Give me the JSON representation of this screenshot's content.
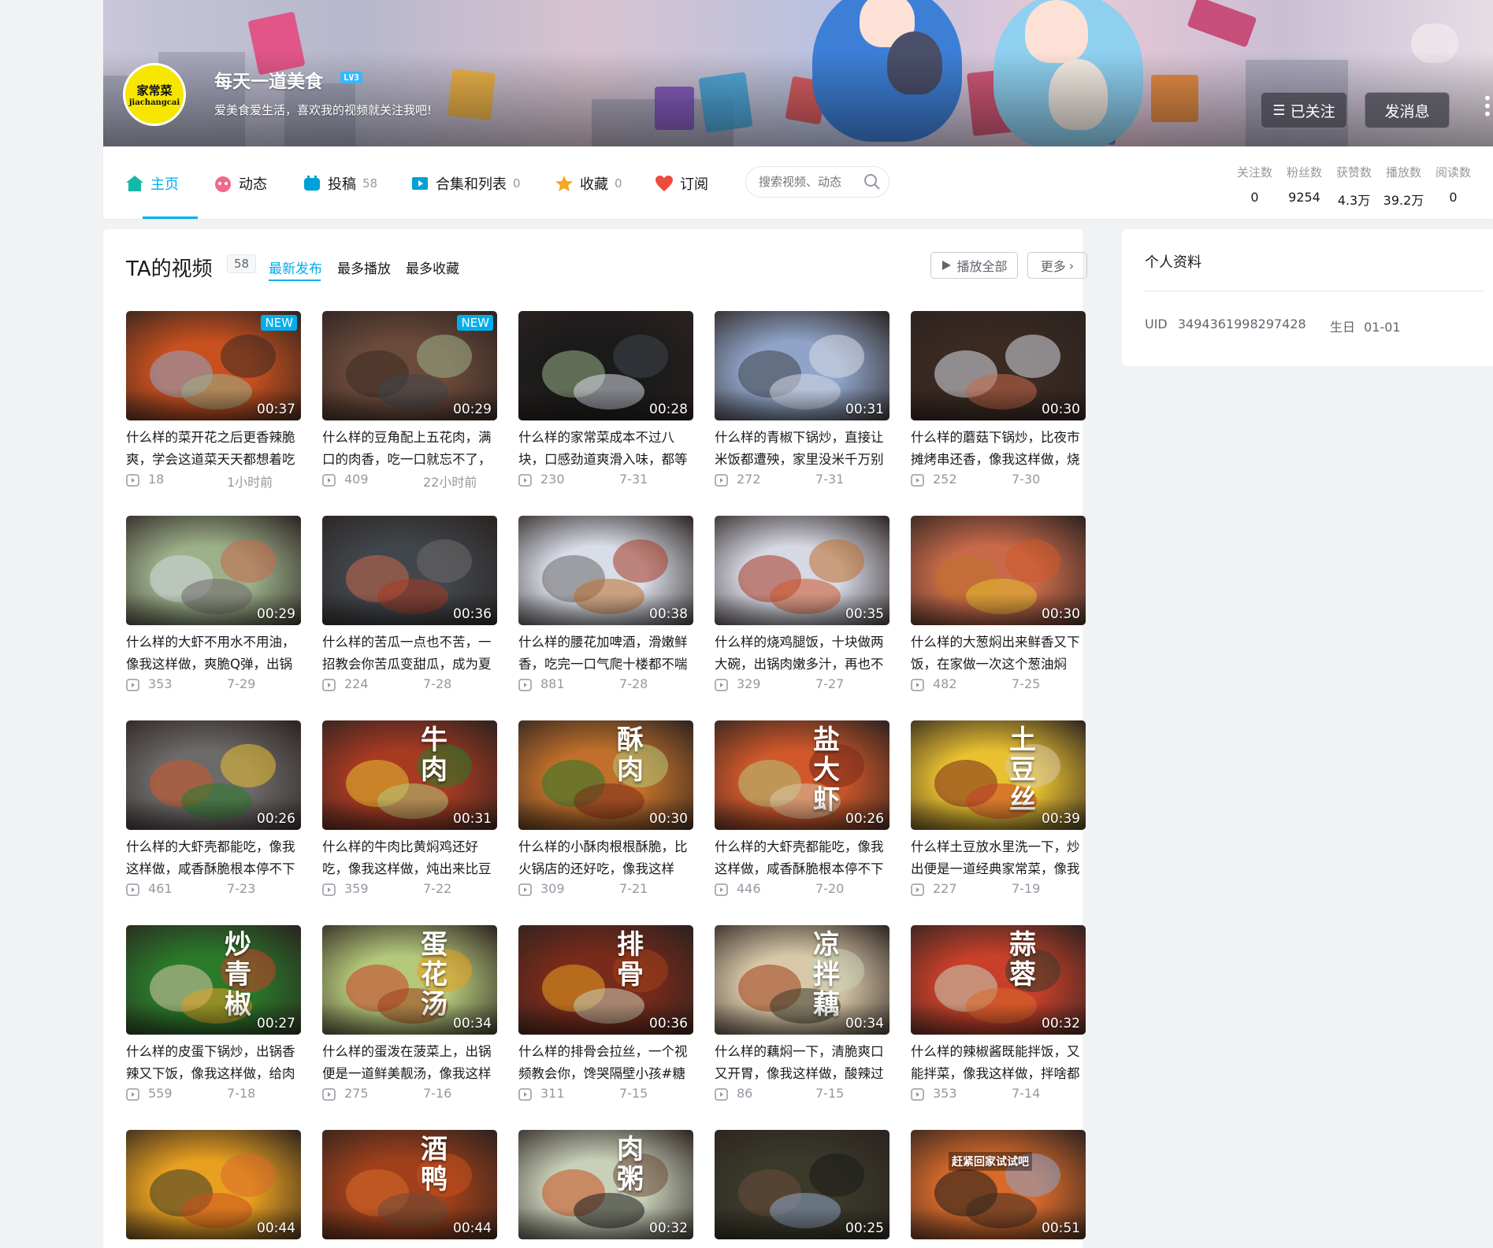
{
  "profile": {
    "username": "每天一道美食",
    "level": "LV3",
    "signature": "爱美食爱生活，喜欢我的视频就关注我吧!",
    "avatar_line1": "家常菜",
    "avatar_line2": "jiachangcai",
    "followed_label": "已关注",
    "message_label": "发消息"
  },
  "nav": {
    "items": [
      {
        "label": "主页",
        "count": "",
        "icon": "home-icon"
      },
      {
        "label": "动态",
        "count": "",
        "icon": "dynamic-icon"
      },
      {
        "label": "投稿",
        "count": "58",
        "icon": "upload-icon"
      },
      {
        "label": "合集和列表",
        "count": "0",
        "icon": "collection-icon"
      },
      {
        "label": "收藏",
        "count": "0",
        "icon": "star-icon"
      },
      {
        "label": "订阅",
        "count": "",
        "icon": "heart-icon"
      }
    ],
    "search_placeholder": "搜索视频、动态"
  },
  "stats": [
    {
      "label": "关注数",
      "value": "0"
    },
    {
      "label": "粉丝数",
      "value": "9254"
    },
    {
      "label": "获赞数",
      "value": "4.3万"
    },
    {
      "label": "播放数",
      "value": "39.2万"
    },
    {
      "label": "阅读数",
      "value": "0"
    }
  ],
  "videos_section": {
    "title": "TA的视频",
    "count": "58",
    "sort_tabs": [
      "最新发布",
      "最多播放",
      "最多收藏"
    ],
    "play_all": "播放全部",
    "more": "更多"
  },
  "videos": [
    {
      "title": "什么样的菜开花之后更香辣脆爽，学会这道菜天天都想着吃",
      "duration": "00:37",
      "plays": "18",
      "date": "1小时前",
      "badge": "NEW"
    },
    {
      "title": "什么样的豆角配上五花肉，满口的肉香，吃一口就忘不了，",
      "duration": "00:29",
      "plays": "409",
      "date": "22小时前",
      "badge": "NEW"
    },
    {
      "title": "什么样的家常菜成本不过八块，口感劲道爽滑入味，都等",
      "duration": "00:28",
      "plays": "230",
      "date": "7-31",
      "badge": ""
    },
    {
      "title": "什么样的青椒下锅炒，直接让米饭都遭殃，家里没米千万别",
      "duration": "00:31",
      "plays": "272",
      "date": "7-31",
      "badge": ""
    },
    {
      "title": "什么样的蘑菇下锅炒，比夜市摊烤串还香，像我这样做，烧",
      "duration": "00:30",
      "plays": "252",
      "date": "7-30",
      "badge": ""
    },
    {
      "title": "什么样的大虾不用水不用油，像我这样做，爽脆Q弹，出锅",
      "duration": "00:29",
      "plays": "353",
      "date": "7-29",
      "badge": ""
    },
    {
      "title": "什么样的苦瓜一点也不苦，一招教会你苦瓜变甜瓜，成为夏",
      "duration": "00:36",
      "plays": "224",
      "date": "7-28",
      "badge": ""
    },
    {
      "title": "什么样的腰花加啤酒，滑嫩鲜香，吃完一口气爬十楼都不喘",
      "duration": "00:38",
      "plays": "881",
      "date": "7-28",
      "badge": ""
    },
    {
      "title": "什么样的烧鸡腿饭，十块做两大碗，出锅肉嫩多汁，再也不",
      "duration": "00:35",
      "plays": "329",
      "date": "7-27",
      "badge": ""
    },
    {
      "title": "什么样的大葱焖出来鲜香又下饭，在家做一次这个葱油焖",
      "duration": "00:30",
      "plays": "482",
      "date": "7-25",
      "badge": ""
    },
    {
      "title": "什么样的大虾壳都能吃，像我这样做，咸香酥脆根本停不下",
      "duration": "00:26",
      "plays": "461",
      "date": "7-23",
      "badge": ""
    },
    {
      "title": "什么样的牛肉比黄焖鸡还好吃，像我这样做，炖出来比豆",
      "duration": "00:31",
      "plays": "359",
      "date": "7-22",
      "badge": ""
    },
    {
      "title": "什么样的小酥肉根根酥脆，比火锅店的还好吃，像我这样",
      "duration": "00:30",
      "plays": "309",
      "date": "7-21",
      "badge": ""
    },
    {
      "title": "什么样的大虾壳都能吃，像我这样做，咸香酥脆根本停不下",
      "duration": "00:26",
      "plays": "446",
      "date": "7-20",
      "badge": ""
    },
    {
      "title": "什么样土豆放水里洗一下，炒出便是一道经典家常菜，像我",
      "duration": "00:39",
      "plays": "227",
      "date": "7-19",
      "badge": ""
    },
    {
      "title": "什么样的皮蛋下锅炒，出锅香辣又下饭，像我这样做，给肉",
      "duration": "00:27",
      "plays": "559",
      "date": "7-18",
      "badge": ""
    },
    {
      "title": "什么样的蛋泼在菠菜上，出锅便是一道鲜美靓汤，像我这样",
      "duration": "00:34",
      "plays": "275",
      "date": "7-16",
      "badge": ""
    },
    {
      "title": "什么样的排骨会拉丝，一个视频教会你，馋哭隔壁小孩#糖",
      "duration": "00:36",
      "plays": "311",
      "date": "7-15",
      "badge": ""
    },
    {
      "title": "什么样的藕焖一下，清脆爽口又开胃，像我这样做，酸辣过",
      "duration": "00:34",
      "plays": "86",
      "date": "7-15",
      "badge": ""
    },
    {
      "title": "什么样的辣椒酱既能拌饭，又能拌菜，像我这样做，拌啥都",
      "duration": "00:32",
      "plays": "353",
      "date": "7-14",
      "badge": ""
    },
    {
      "title": "",
      "duration": "00:44",
      "plays": "",
      "date": "",
      "badge": ""
    },
    {
      "title": "",
      "duration": "00:44",
      "plays": "",
      "date": "",
      "badge": ""
    },
    {
      "title": "",
      "duration": "00:32",
      "plays": "",
      "date": "",
      "badge": ""
    },
    {
      "title": "",
      "duration": "00:25",
      "plays": "",
      "date": "",
      "badge": ""
    },
    {
      "title": "",
      "duration": "00:51",
      "plays": "",
      "date": "",
      "badge": ""
    }
  ],
  "thumb_overlays": {
    "12": "牛肉",
    "13": "酥肉",
    "14": "盐大虾",
    "15": "土豆丝",
    "16": "炒青椒",
    "17": "蛋花汤",
    "18": "排骨",
    "19": "凉拌藕",
    "20": "蒜蓉",
    "22": "酒鸭",
    "23": "肉粥",
    "25": "赶紧回家试试吧"
  },
  "sidebar": {
    "title": "个人资料",
    "uid_label": "UID",
    "uid": "3494361998297428",
    "birthday_label": "生日",
    "birthday": "01-01"
  },
  "colors": {
    "accent": "#00aeec",
    "thumb_palette": [
      "#c8501e",
      "#6b4a3a",
      "#1a1a1a",
      "#8fa4c8",
      "#3a2a22",
      "#9cb08a",
      "#40464c",
      "#d8dde8",
      "#d6d8e4",
      "#c86a4a",
      "#6d6a6a",
      "#a83a22",
      "#c0702a",
      "#d0582a",
      "#e8c030",
      "#2a7a2a",
      "#b4c87a",
      "#7a2a1a",
      "#d8c8a8",
      "#c8402a",
      "#e8a020",
      "#a0401a",
      "#c8d0b8",
      "#3a3a2a",
      "#d86a2a"
    ]
  }
}
